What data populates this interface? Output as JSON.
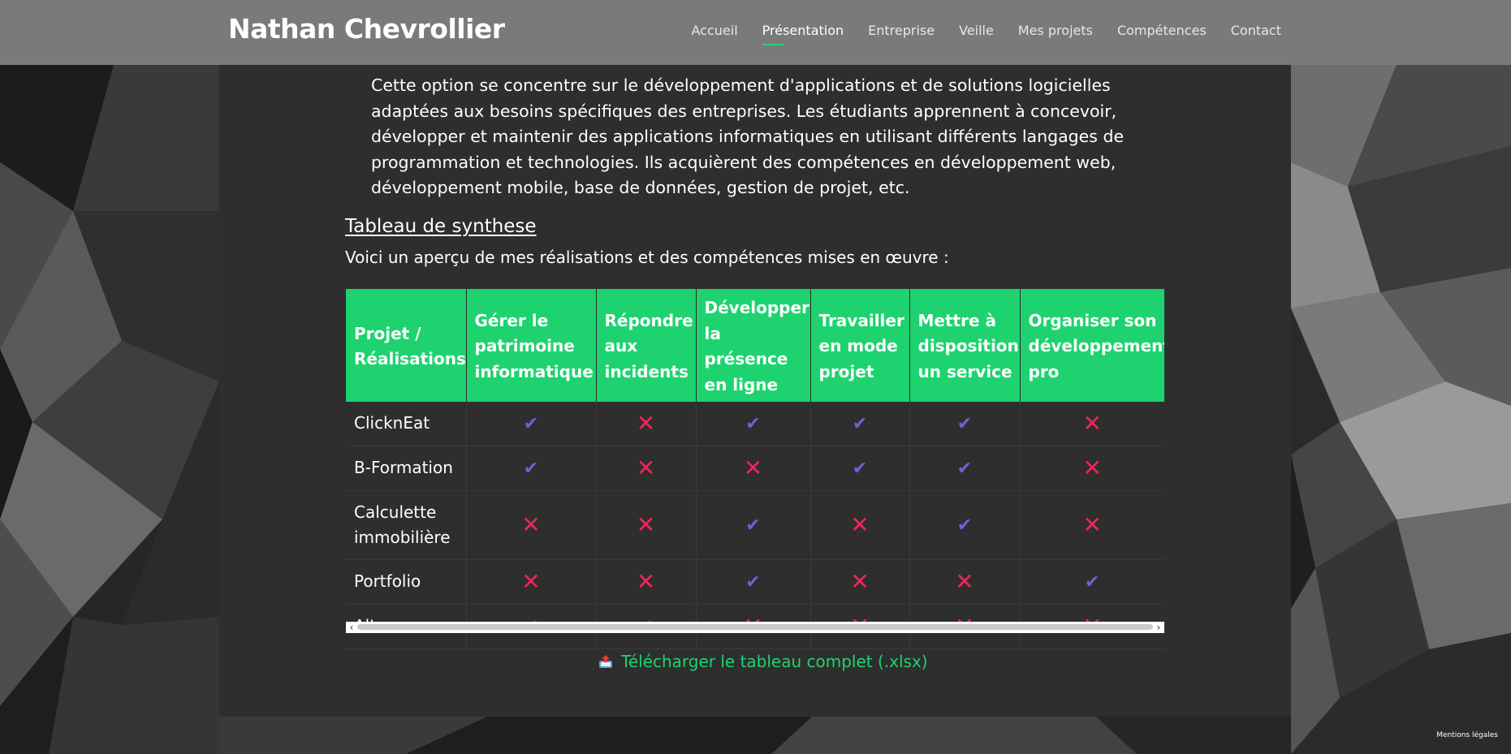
{
  "header": {
    "brand": "Nathan Chevrollier",
    "nav": [
      {
        "label": "Accueil",
        "active": false
      },
      {
        "label": "Présentation",
        "active": true
      },
      {
        "label": "Entreprise",
        "active": false
      },
      {
        "label": "Veille",
        "active": false
      },
      {
        "label": "Mes projets",
        "active": false
      },
      {
        "label": "Compétences",
        "active": false
      },
      {
        "label": "Contact",
        "active": false
      }
    ]
  },
  "intro": {
    "text": "Cette option se concentre sur le développement d'applications et de solutions logicielles adaptées aux besoins spécifiques des entreprises. Les étudiants apprennent à concevoir, développer et maintenir des applications informatiques en utilisant différents langages de programmation et technologies. Ils acquièrent des compétences en développement web, développement mobile, base de données, gestion de projet, etc."
  },
  "section": {
    "title": "Tableau de synthese",
    "subtitle": "Voici un aperçu de mes réalisations et des compétences mises en œuvre :"
  },
  "table": {
    "headers": [
      "Projet / Réalisations",
      "Gérer le patrimoine informatique",
      "Répondre aux incidents",
      "Développer la présence en ligne",
      "Travailler en mode projet",
      "Mettre à disposition un service",
      "Organiser son développement pro"
    ],
    "rows": [
      {
        "name": "ClicknEat",
        "marks": [
          "check",
          "cross",
          "check",
          "check",
          "check",
          "cross"
        ]
      },
      {
        "name": "B-Formation",
        "marks": [
          "check",
          "cross",
          "cross",
          "check",
          "check",
          "cross"
        ]
      },
      {
        "name": "Calculette immobilière",
        "marks": [
          "cross",
          "cross",
          "check",
          "cross",
          "check",
          "cross"
        ]
      },
      {
        "name": "Portfolio",
        "marks": [
          "cross",
          "cross",
          "check",
          "cross",
          "cross",
          "check"
        ]
      },
      {
        "name": "Alternance",
        "marks": [
          "check",
          "check",
          "cross",
          "cross",
          "cross",
          "cross"
        ]
      }
    ],
    "mark_symbols": {
      "check": "✔",
      "cross": "✕"
    },
    "scroll_left": "‹",
    "scroll_right": "›"
  },
  "download": {
    "label": "Télécharger le tableau complet (.xlsx)",
    "icon": "outbox-tray-icon"
  },
  "footer": {
    "legal": "Mentions légales"
  },
  "colors": {
    "accent": "#1ed36f",
    "check": "#7a5bd6",
    "cross": "#f0245a",
    "header_bg": "#7a7a7a",
    "panel_bg": "#2e2e2e"
  }
}
